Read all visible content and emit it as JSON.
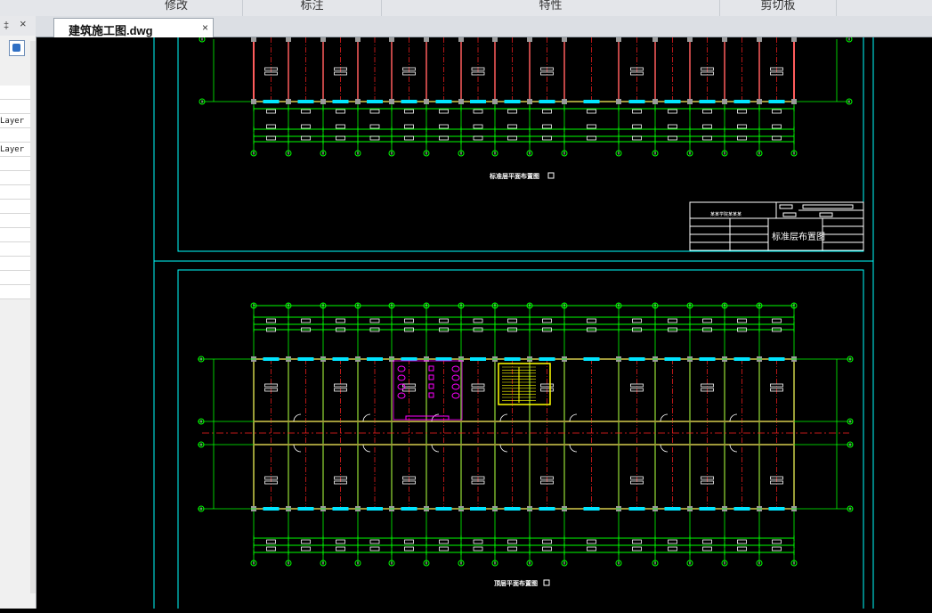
{
  "ribbon": {
    "groups": [
      "修改",
      "标注",
      "特性",
      "剪切板"
    ]
  },
  "palette": {
    "pin_icon": "pin-icon",
    "close_glyph": "×",
    "rows": [
      "",
      "",
      "Layer",
      "",
      "Layer",
      "",
      "",
      "",
      "",
      "",
      "",
      "",
      "",
      "",
      ""
    ]
  },
  "document_tab": {
    "title": "建筑施工图.dwg",
    "close_glyph": "×"
  },
  "drawing": {
    "upper_sheet_caption": "标准层平面布置图",
    "lower_sheet_caption": "顶层平面布置图",
    "title_block_name": "标准层布置图",
    "title_block_header": "某某学院某某某"
  },
  "colors": {
    "background": "#000000",
    "sheet_frame": "#00ffff",
    "axis_lines": "#00ff00",
    "walls": "#ff5c5c",
    "center_lines": "#ff2020",
    "windows": "#00e5ff",
    "stair": "#ffff00",
    "sanitary": "#ff00ff",
    "text": "#ffffff"
  }
}
